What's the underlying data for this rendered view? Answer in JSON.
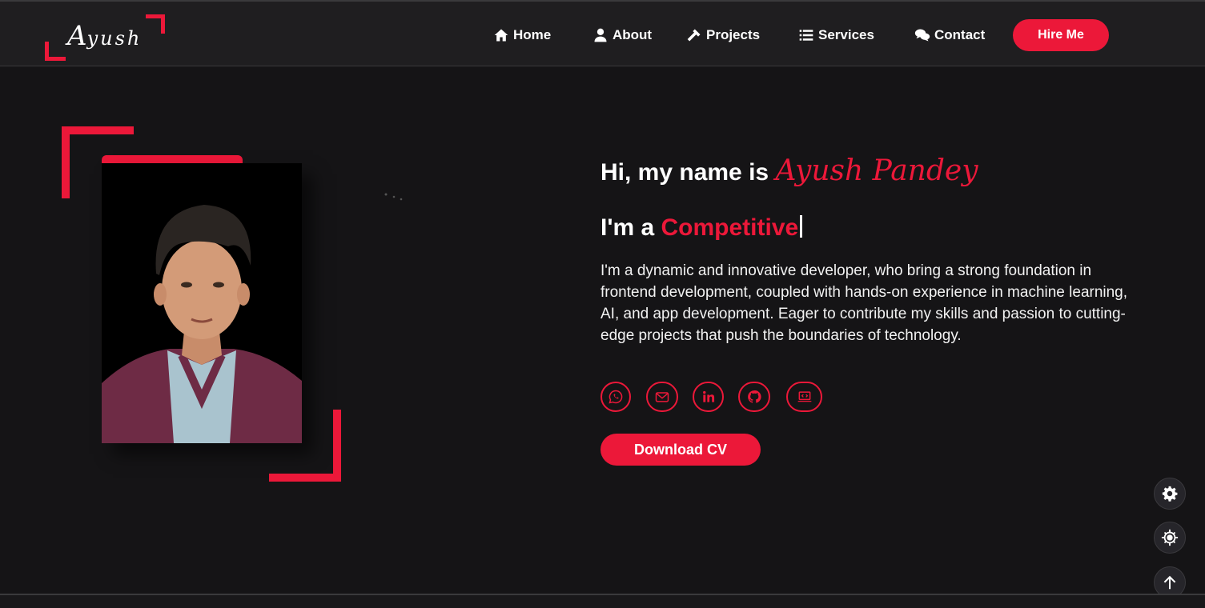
{
  "colors": {
    "accent": "#ec1839",
    "background": "#151416",
    "navbar": "#1f1e20"
  },
  "logo": {
    "first_letter": "A",
    "rest": "yush"
  },
  "nav": {
    "items": [
      {
        "label": "Home",
        "icon": "home-icon"
      },
      {
        "label": "About",
        "icon": "user-icon"
      },
      {
        "label": "Projects",
        "icon": "hammer-icon"
      },
      {
        "label": "Services",
        "icon": "list-icon"
      },
      {
        "label": "Contact",
        "icon": "comments-icon"
      }
    ],
    "hire_label": "Hire Me"
  },
  "hero": {
    "greeting": "Hi, my name is ",
    "name": "Ayush Pandey",
    "role_prefix": "I'm a ",
    "role_word": "Competitive",
    "bio": "I'm a dynamic and innovative developer, who bring a strong foundation in frontend development, coupled with hands-on experience in machine learning, AI, and app development. Eager to contribute my skills and passion to cutting-edge projects that push the boundaries of technology.",
    "socials": [
      "whatsapp-icon",
      "email-icon",
      "linkedin-icon",
      "github-icon",
      "code-laptop-icon"
    ],
    "cv_label": "Download CV"
  },
  "floating": [
    "settings-icon",
    "theme-gear-icon",
    "arrow-up-icon"
  ]
}
